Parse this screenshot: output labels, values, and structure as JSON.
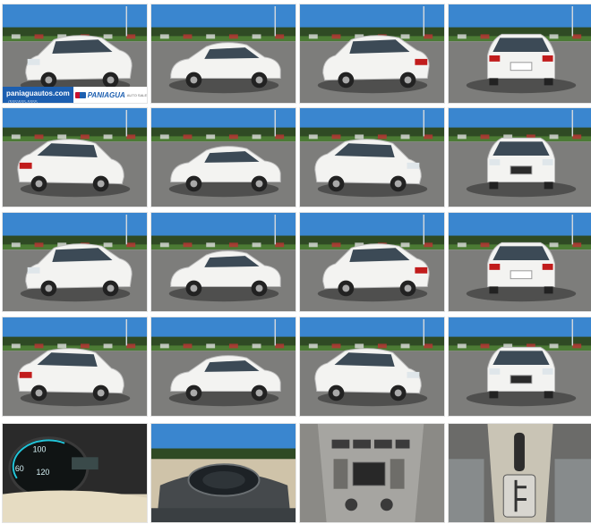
{
  "gallery": {
    "watermark": {
      "site": "paniaguautos.com",
      "phone": "(555)555-5555",
      "brand": "PANIAGUA",
      "brand_tag": "AUTO SALES"
    },
    "photos": [
      {
        "view": "front-left",
        "scene": "lot-sunny",
        "wm": true
      },
      {
        "view": "side-left",
        "scene": "lot-sunny"
      },
      {
        "view": "rear-right",
        "scene": "lot-sunny"
      },
      {
        "view": "rear",
        "scene": "lot-sunny"
      },
      {
        "view": "rear-left",
        "scene": "lot-trees"
      },
      {
        "view": "side-left",
        "scene": "lot-trees"
      },
      {
        "view": "front-right",
        "scene": "lot-trees"
      },
      {
        "view": "front",
        "scene": "lot-trees"
      },
      {
        "view": "front-left",
        "scene": "lot-sunny"
      },
      {
        "view": "side-left",
        "scene": "lot-sunny"
      },
      {
        "view": "rear-right",
        "scene": "lot-sunny"
      },
      {
        "view": "rear",
        "scene": "lot-sunny"
      },
      {
        "view": "rear-left",
        "scene": "lot-trees"
      },
      {
        "view": "side-left",
        "scene": "lot-trees"
      },
      {
        "view": "front-right",
        "scene": "lot-trees"
      },
      {
        "view": "front",
        "scene": "lot-trees"
      },
      {
        "view": "gauge",
        "scene": "interior"
      },
      {
        "view": "dash",
        "scene": "interior-window"
      },
      {
        "view": "console",
        "scene": "interior"
      },
      {
        "view": "shifter",
        "scene": "interior"
      }
    ],
    "colors": {
      "sky": "#3a86cf",
      "asphalt": "#7d7d7b",
      "grass": "#4b7a34",
      "trees": "#2f4a24",
      "car_white": "#f3f3f1",
      "tail_red": "#c11c1c",
      "glass": "#3c4a56",
      "interior": "#8a8884"
    },
    "gauge_labels": [
      "60",
      "100",
      "120"
    ]
  }
}
